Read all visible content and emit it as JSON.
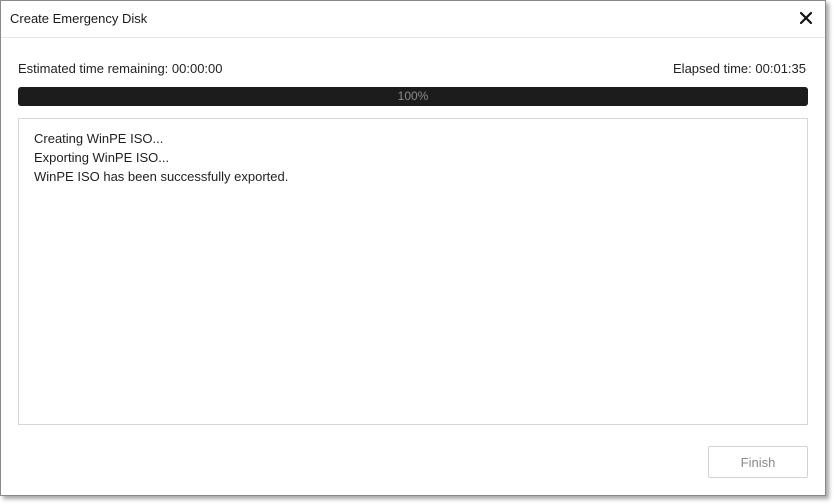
{
  "window": {
    "title": "Create Emergency Disk",
    "close_icon": "close-icon"
  },
  "status": {
    "estimated_time_remaining": "Estimated time remaining: 00:00:00",
    "elapsed_time": "Elapsed time: 00:01:35"
  },
  "progress": {
    "percent": 100,
    "label": "100%",
    "fill_color": "#1c1c1c"
  },
  "log": {
    "lines": [
      "Creating WinPE ISO...",
      "Exporting WinPE ISO...",
      "WinPE ISO has been successfully exported."
    ]
  },
  "footer": {
    "finish_label": "Finish"
  }
}
